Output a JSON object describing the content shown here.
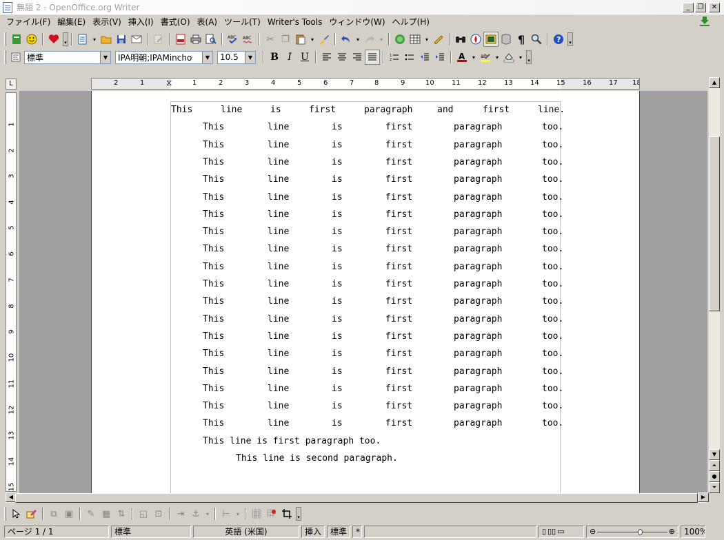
{
  "window": {
    "title": "無題 2 - OpenOffice.org Writer"
  },
  "menu": [
    "ファイル(F)",
    "編集(E)",
    "表示(V)",
    "挿入(I)",
    "書式(O)",
    "表(A)",
    "ツール(T)",
    "Writer's Tools",
    "ウィンドウ(W)",
    "ヘルプ(H)"
  ],
  "format_bar": {
    "style": "標準",
    "font": "IPA明朝;IPAMincho",
    "size": "10.5"
  },
  "ruler": {
    "marks": [
      "2",
      "1",
      "1",
      "2",
      "3",
      "4",
      "5",
      "6",
      "7",
      "8",
      "9",
      "10",
      "11",
      "12",
      "13",
      "14",
      "15",
      "16",
      "17",
      "18"
    ]
  },
  "vruler": {
    "marks": [
      "1",
      "2",
      "3",
      "4",
      "5",
      "6",
      "7",
      "8",
      "9",
      "10",
      "11",
      "12",
      "13",
      "14",
      "15"
    ]
  },
  "document": {
    "first_line": [
      "This",
      "line",
      "is",
      "first",
      "paragraph",
      "and",
      "first",
      "line."
    ],
    "repeat_words": [
      "This",
      "line",
      "is",
      "first",
      "paragraph",
      "too."
    ],
    "repeat_count": 18,
    "last_line_para1": "This line is first paragraph too.",
    "para2": "This line is second paragraph."
  },
  "status": {
    "page": "ページ 1 / 1",
    "style": "標準",
    "language": "英語 (米国)",
    "insert_mode": "挿入",
    "selection_mode": "標準",
    "modified": "*",
    "zoom": "100%"
  }
}
